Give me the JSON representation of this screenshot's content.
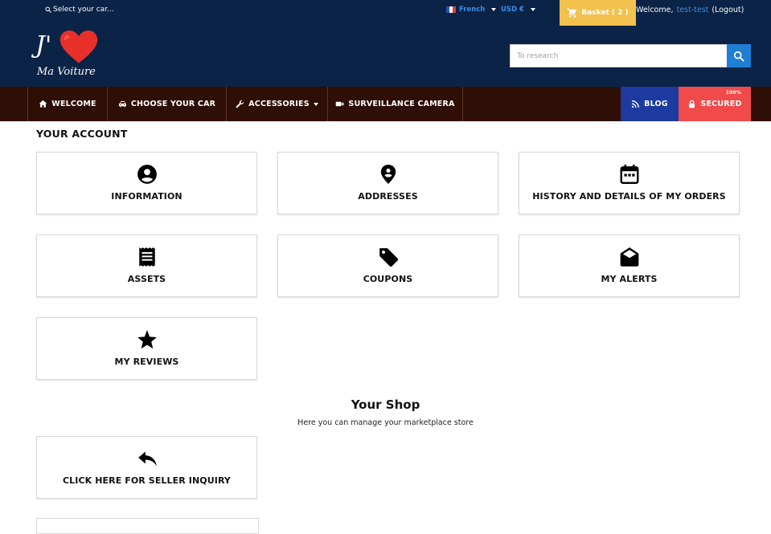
{
  "header": {
    "select_car": "Select your car...",
    "language": "French",
    "currency": "USD €",
    "basket": "Basket ( 2 )",
    "welcome": "Welcome,",
    "username": "test-test",
    "logout": "(Logout)",
    "search_placeholder": "To research",
    "logo_text_top": "J'",
    "logo_text_bottom": "Ma Voiture"
  },
  "nav": {
    "items": [
      {
        "label": "WELCOME",
        "icon": "home-icon"
      },
      {
        "label": "CHOOSE YOUR CAR",
        "icon": "car-icon"
      },
      {
        "label": "ACCESSORIES",
        "icon": "wrench-icon"
      },
      {
        "label": "SURVEILLANCE CAMERA",
        "icon": "video-camera-icon"
      }
    ],
    "blog": "BLOG",
    "secured": "SECURED",
    "secured_badge": "100%"
  },
  "account": {
    "title": "YOUR ACCOUNT",
    "cards": [
      {
        "label": "INFORMATION",
        "icon": "user-circle-icon"
      },
      {
        "label": "ADDRESSES",
        "icon": "location-pin-icon"
      },
      {
        "label": "HISTORY AND DETAILS OF MY ORDERS",
        "icon": "calendar-icon"
      },
      {
        "label": "ASSETS",
        "icon": "receipt-icon"
      },
      {
        "label": "COUPONS",
        "icon": "tag-icon"
      },
      {
        "label": "MY ALERTS",
        "icon": "envelope-open-icon"
      },
      {
        "label": "MY REVIEWS",
        "icon": "star-icon"
      }
    ]
  },
  "shop": {
    "title": "Your Shop",
    "subtitle": "Here you can manage your marketplace store",
    "cards": [
      {
        "label": "CLICK HERE FOR SELLER INQUIRY",
        "icon": "reply-arrow-icon"
      }
    ]
  },
  "colors": {
    "header_bg": "#0b2346",
    "nav_bg": "#2e0e05",
    "basket_bg": "#f2c14e",
    "blog_bg": "#1c3aa0",
    "secured_bg": "#f04a4a",
    "link_blue": "#3a8ee6",
    "logo_heart": "#e8302b"
  }
}
